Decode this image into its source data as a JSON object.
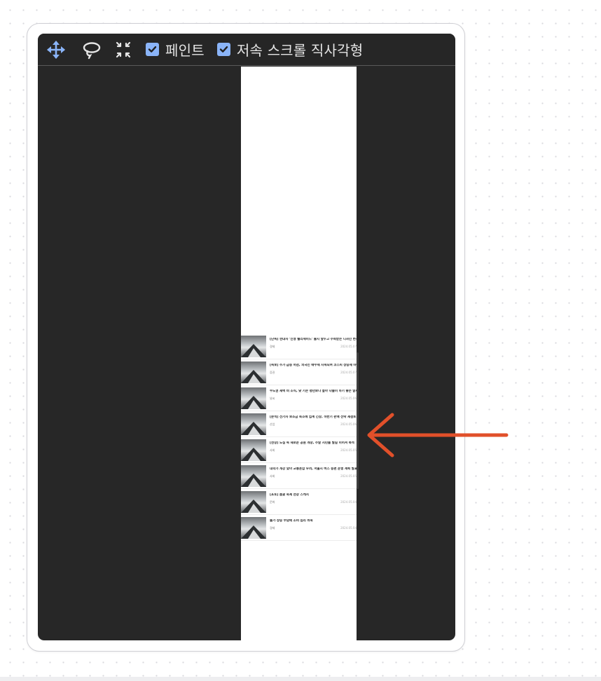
{
  "toolbar": {
    "tools": [
      {
        "icon": "move-icon",
        "color": "#8ab4f8"
      },
      {
        "icon": "lasso-icon",
        "color": "#e6e6e6"
      },
      {
        "icon": "collapse-icon",
        "color": "#e6e6e6"
      }
    ],
    "paint": {
      "label": "페인트",
      "checked": true
    },
    "scroll_capture": {
      "label": "저속 스크롤 직사각형",
      "checked": true
    }
  },
  "preview": {
    "items": [
      {
        "title": "[단독] 현대차 '신형 팰리세이드' 출시 앞두고 주목받는 디자인 변경 사항 정리",
        "category": "경제",
        "date": "2024.05.07"
      },
      {
        "title": "[속보] 주가 급등 마감, 외국인 매수세 지속되며 코스피 상승세 이어가",
        "category": "증권",
        "date": "2024.05.07"
      },
      {
        "title": "수도권 새벽 비 소식, 낮 기온 평년보다 높아 나들이 하기 좋은 날씨 전망",
        "category": "날씨",
        "date": "2024.05.06"
      },
      {
        "title": "[분석] 전기차 보조금 축소에 업계 긴장, 하반기 판매 전략 재검토 착수",
        "category": "산업",
        "date": "2024.05.06"
      },
      {
        "title": "[현장] 도심 속 새로운 공원 개장, 주말 시민들 발길 이어져 북적",
        "category": "사회",
        "date": "2024.05.05"
      },
      {
        "title": "대학가 개강 맞아 교통혼잡 우려, 서울시 버스 증편 운행 계획 발표",
        "category": "사회",
        "date": "2024.05.05"
      },
      {
        "title": "[포토] 봄꽃 축제 현장 스케치",
        "category": "문화",
        "date": "2024.05.04"
      },
      {
        "title": "물가 상승 부담에 소비 심리 위축",
        "category": "경제",
        "date": "2024.05.04"
      }
    ]
  },
  "annotation": {
    "arrow_color": "#e1502a"
  }
}
